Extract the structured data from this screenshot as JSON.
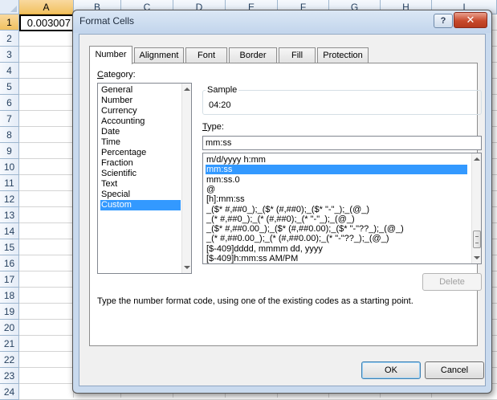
{
  "spreadsheet": {
    "columns": [
      "A",
      "B",
      "C",
      "D",
      "E",
      "F",
      "G",
      "H",
      "I"
    ],
    "rows": [
      "1",
      "2",
      "3",
      "4",
      "5",
      "6",
      "7",
      "8",
      "9",
      "10",
      "11",
      "12",
      "13",
      "14",
      "15",
      "16",
      "17",
      "18",
      "19",
      "20",
      "21",
      "22",
      "23",
      "24"
    ],
    "active_cell_value": "0.003007"
  },
  "dialog": {
    "title": "Format Cells",
    "help_label": "?",
    "close_label": "✕",
    "tabs": [
      "Number",
      "Alignment",
      "Font",
      "Border",
      "Fill",
      "Protection"
    ],
    "active_tab": "Number",
    "category_label_prefix": "C",
    "category_label_rest": "ategory:",
    "categories": [
      "General",
      "Number",
      "Currency",
      "Accounting",
      "Date",
      "Time",
      "Percentage",
      "Fraction",
      "Scientific",
      "Text",
      "Special",
      "Custom"
    ],
    "selected_category": "Custom",
    "sample_label": "Sample",
    "sample_value": "04:20",
    "type_label_prefix": "T",
    "type_label_rest": "ype:",
    "type_value": "mm:ss",
    "formats": [
      "m/d/yyyy h:mm",
      "mm:ss",
      "mm:ss.0",
      "@",
      "[h]:mm:ss",
      "_($* #,##0_);_($* (#,##0);_($* \"-\"_);_(@_)",
      "_(* #,##0_);_(* (#,##0);_(* \"-\"_);_(@_)",
      "_($* #,##0.00_);_($* (#,##0.00);_($* \"-\"??_);_(@_)",
      "_(* #,##0.00_);_(* (#,##0.00);_(* \"-\"??_);_(@_)",
      "[$-409]dddd, mmmm dd, yyyy",
      "[$-409]h:mm:ss AM/PM"
    ],
    "selected_format": "mm:ss",
    "delete_label": "Delete",
    "description": "Type the number format code, using one of the existing codes as a starting point.",
    "ok_label": "OK",
    "cancel_label": "Cancel",
    "colors": {
      "selection": "#3399ff",
      "column_highlight": "#f1c15f",
      "close_button": "#c84a2c"
    }
  }
}
